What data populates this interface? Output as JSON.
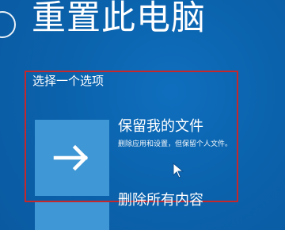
{
  "page": {
    "title": "重置此电脑"
  },
  "dialog": {
    "heading": "选择一个选项",
    "options": [
      {
        "icon": "arrow-right-icon",
        "title": "保留我的文件",
        "description": "删除应用和设置，但保留个人文件。"
      },
      {
        "title": "删除所有内容"
      }
    ]
  },
  "colors": {
    "background": "#0a61aa",
    "tile": "#3f97d5",
    "highlight_border": "#c4282d",
    "text": "#ffffff"
  }
}
